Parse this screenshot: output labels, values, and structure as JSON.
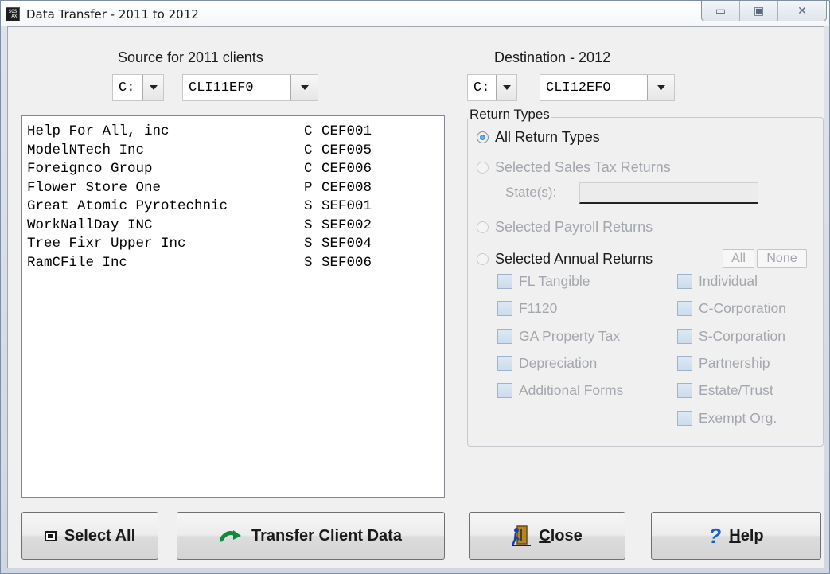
{
  "window": {
    "title": "Data Transfer - 2011 to 2012",
    "controls": {
      "minimize": "▭",
      "maximize": "▣",
      "close": "✕"
    }
  },
  "source": {
    "label": "Source for 2011 clients",
    "drive": "C:",
    "folder": "CLI11EF0"
  },
  "destination": {
    "label": "Destination - 2012",
    "drive": "C:",
    "folder": "CLI12EFO"
  },
  "clients": [
    {
      "name": "Help For All, inc",
      "type": "C",
      "code": "CEF001"
    },
    {
      "name": "ModelNTech Inc",
      "type": "C",
      "code": "CEF005"
    },
    {
      "name": "Foreignco Group",
      "type": "C",
      "code": "CEF006"
    },
    {
      "name": "Flower Store One",
      "type": "P",
      "code": "CEF008"
    },
    {
      "name": "Great Atomic Pyrotechnic",
      "type": "S",
      "code": "SEF001"
    },
    {
      "name": "WorkNallDay INC",
      "type": "S",
      "code": "SEF002"
    },
    {
      "name": "Tree Fixr Upper Inc",
      "type": "S",
      "code": "SEF004"
    },
    {
      "name": "RamCFile Inc",
      "type": "S",
      "code": "SEF006"
    }
  ],
  "return_types": {
    "title": "Return Types",
    "options": {
      "all": "All Return Types",
      "sales_tax": "Selected Sales Tax Returns",
      "payroll": "Selected Payroll Returns",
      "annual": "Selected Annual Returns"
    },
    "selected": "all",
    "state_label": "State(s):",
    "state_value": "",
    "all_button": "All",
    "none_button": "None",
    "forms_left": {
      "fl_tangible": {
        "pre": "FL ",
        "u": "T",
        "post": "angible"
      },
      "f1120": {
        "pre": "",
        "u": "F",
        "post": "1120"
      },
      "ga_property": {
        "pre": "GA Property Tax",
        "u": "",
        "post": ""
      },
      "depreciation": {
        "pre": "",
        "u": "D",
        "post": "epreciation"
      },
      "additional": {
        "pre": "Additional Forms",
        "u": "",
        "post": ""
      }
    },
    "forms_right": {
      "individual": {
        "pre": "",
        "u": "I",
        "post": "ndividual"
      },
      "c_corp": {
        "pre": "",
        "u": "C",
        "post": "-Corporation"
      },
      "s_corp": {
        "pre": "",
        "u": "S",
        "post": "-Corporation"
      },
      "partnership": {
        "pre": "",
        "u": "P",
        "post": "artnership"
      },
      "estate": {
        "pre": "",
        "u": "E",
        "post": "state/Trust"
      },
      "exempt": {
        "pre": "Exempt Org.",
        "u": "",
        "post": ""
      }
    }
  },
  "buttons": {
    "select_all": "Select All",
    "transfer": "Transfer Client Data",
    "close_u": "C",
    "close_rest": "lose",
    "help_u": "H",
    "help_rest": "elp"
  }
}
